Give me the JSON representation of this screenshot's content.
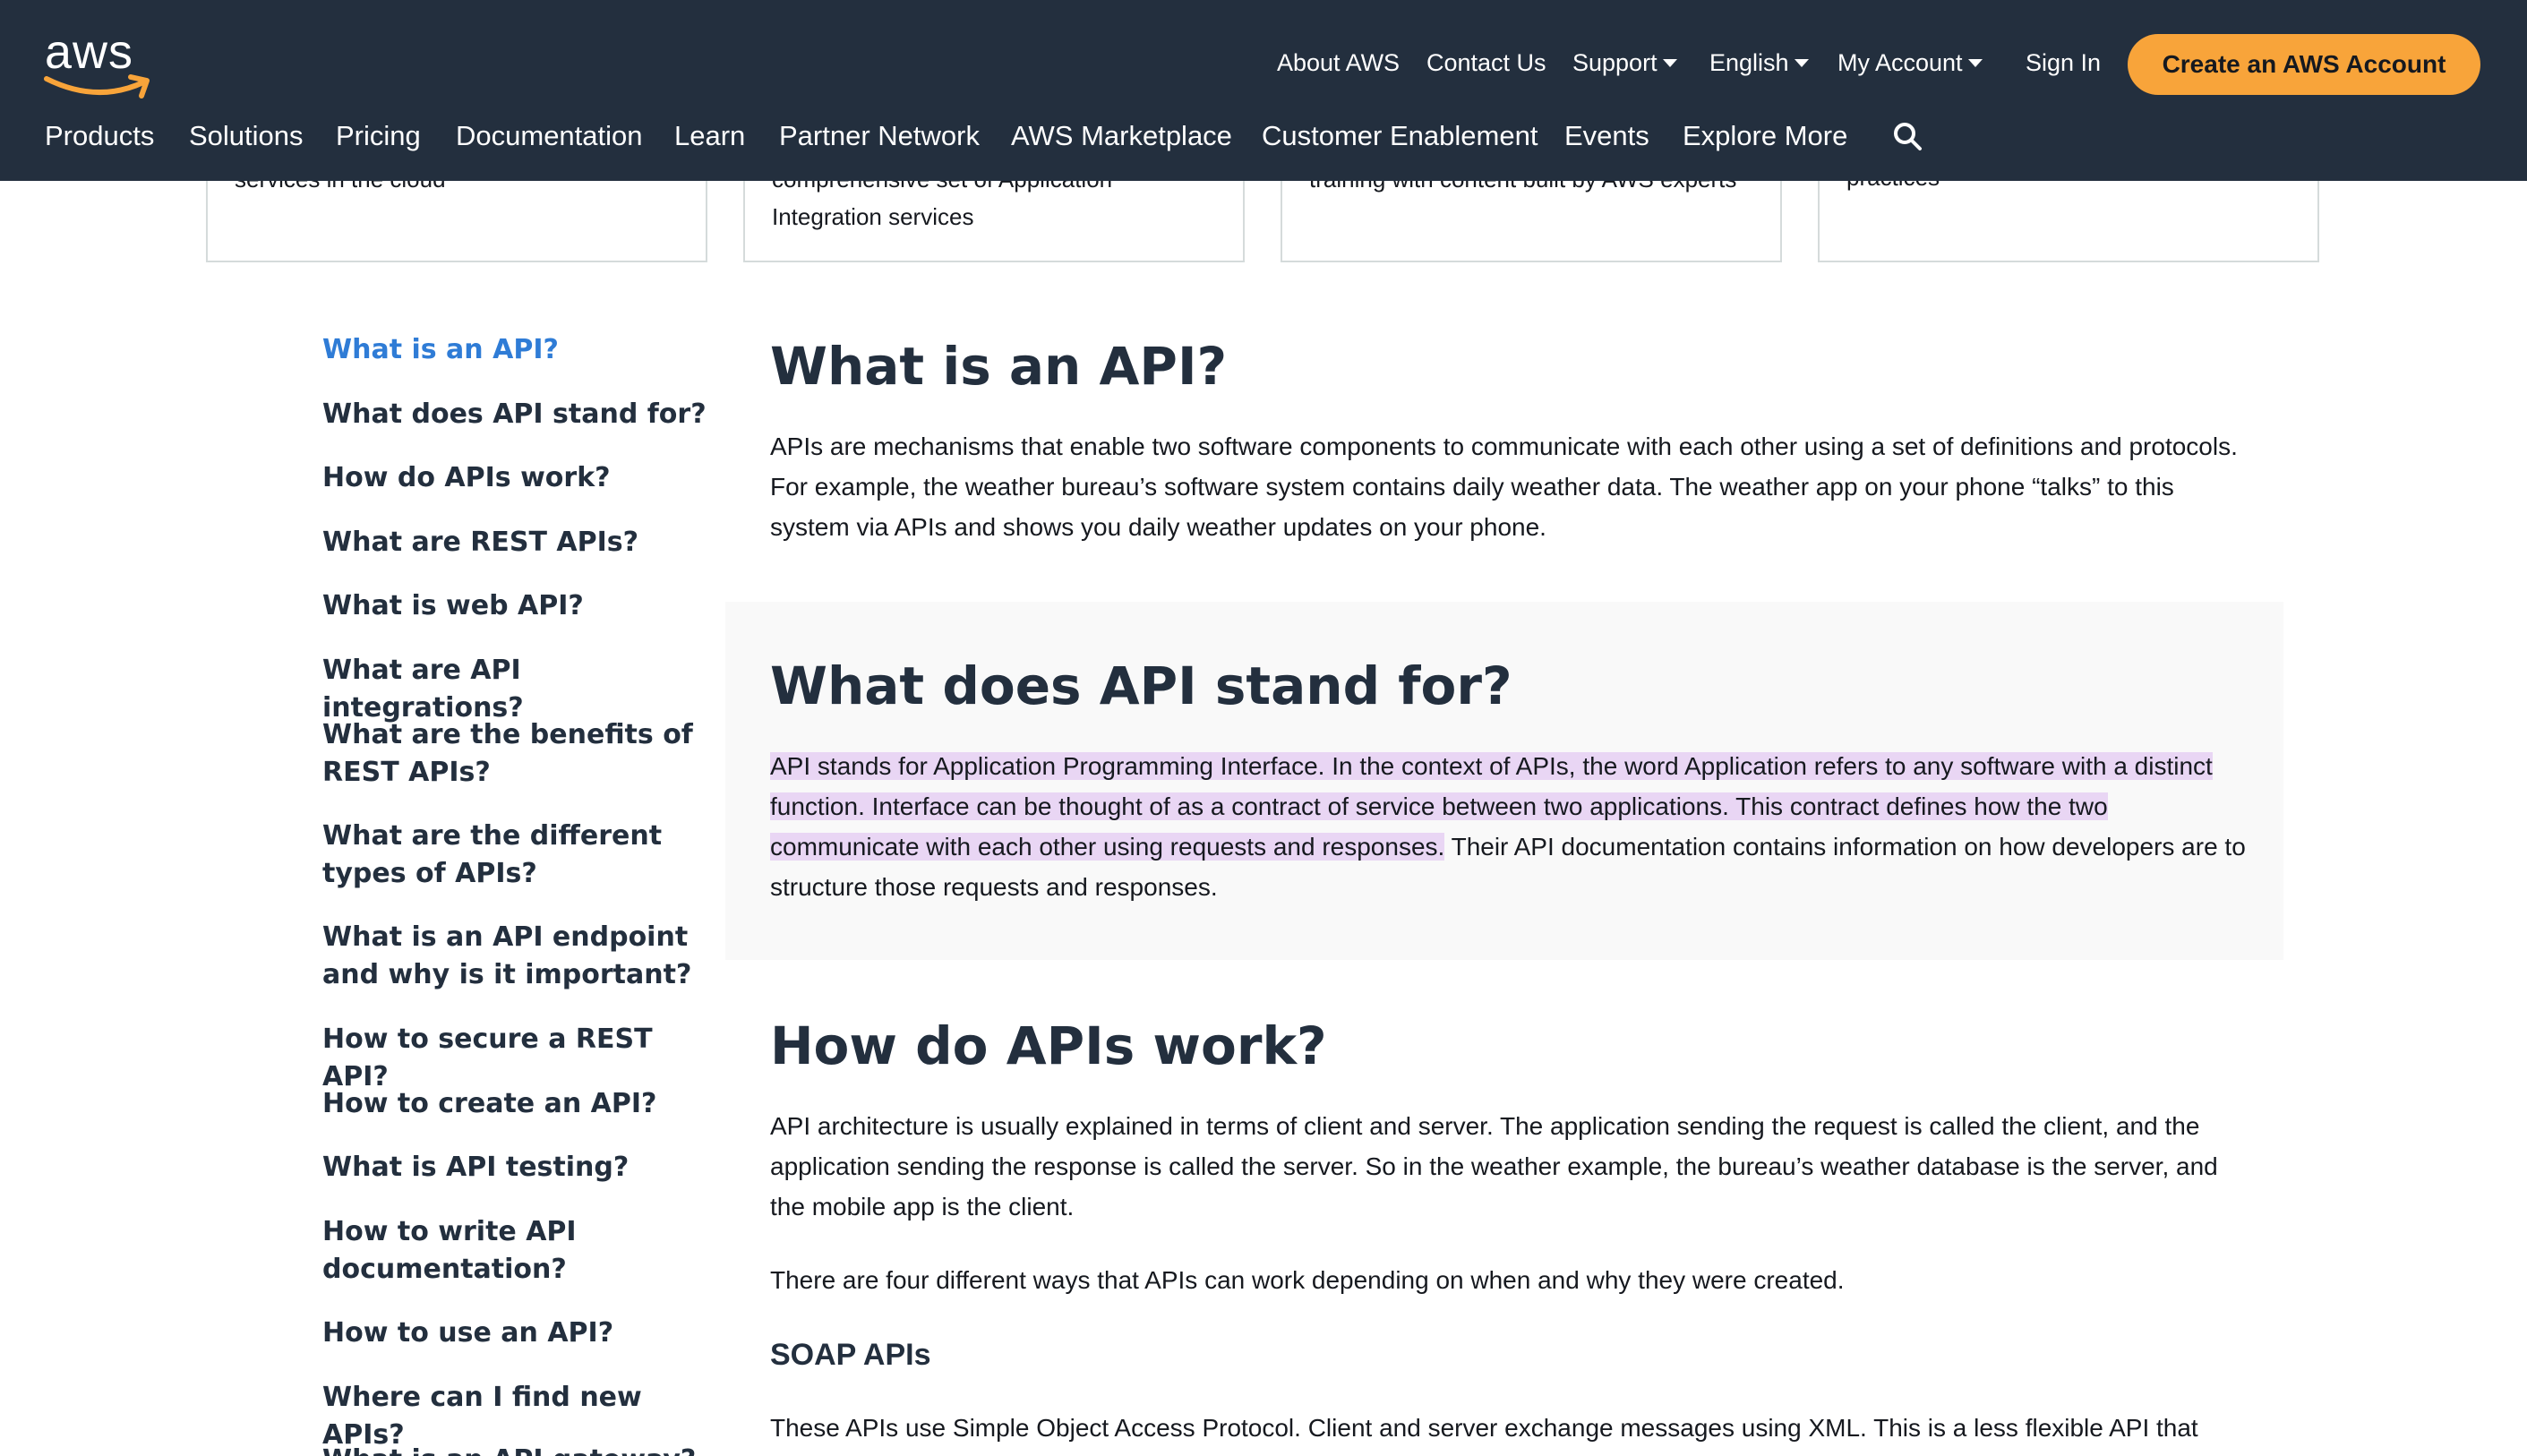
{
  "header": {
    "logo_text": "aws",
    "utility": {
      "about": "About AWS",
      "contact": "Contact Us",
      "support": "Support",
      "language": "English",
      "account": "My Account",
      "sign_in": "Sign In",
      "create_account": "Create an AWS Account"
    },
    "nav": [
      "Products",
      "Solutions",
      "Pricing",
      "Documentation",
      "Learn",
      "Partner Network",
      "AWS Marketplace",
      "Customer Enablement",
      "Events",
      "Explore More"
    ],
    "colors": {
      "background": "#232f3e",
      "cta": "#f8a43a"
    }
  },
  "cards": [
    {
      "lines": [
        "services in the cloud"
      ]
    },
    {
      "lines": [
        "comprehensive set of Application",
        "Integration services"
      ]
    },
    {
      "lines": [
        "training with content built by AWS experts"
      ]
    },
    {
      "lines": [
        "practices"
      ]
    }
  ],
  "toc": [
    {
      "label": "What is an API?",
      "active": true
    },
    {
      "label": "What does API stand for?"
    },
    {
      "label": "How do APIs work?"
    },
    {
      "label": "What are REST APIs?"
    },
    {
      "label": "What is web API?"
    },
    {
      "label": "What are API integrations?"
    },
    {
      "label": "What are the benefits of REST APIs?"
    },
    {
      "label": "What are the different types of APIs?"
    },
    {
      "label": "What is an API endpoint and why is it important?"
    },
    {
      "label": "How to secure a REST API?"
    },
    {
      "label": "How to create an API?"
    },
    {
      "label": "What is API testing?"
    },
    {
      "label": "How to write API documentation?"
    },
    {
      "label": "How to use an API?"
    },
    {
      "label": "Where can I find new APIs?"
    },
    {
      "label": "What is an API gateway?"
    }
  ],
  "content": {
    "s1_title": "What is an API?",
    "s1_p1": "APIs are mechanisms that enable two software components to communicate with each other using a set of definitions and protocols. For example, the weather bureau’s software system contains daily weather data. The weather app on your phone “talks” to this system via APIs and shows you daily weather updates on your phone.",
    "s2_title": "What does API stand for?",
    "s2_highlight": "API stands for Application Programming Interface. In the context of APIs, the word Application refers to any software with a distinct function. Interface can be thought of as a contract of service between two applications. This contract defines how the two communicate with each other using requests and responses.",
    "s2_rest": " Their API documentation contains information on how developers are to structure those requests and responses.",
    "s3_title": "How do APIs work?",
    "s3_p1": "API architecture is usually explained in terms of client and server. The application sending the request is called the client, and the application sending the response is called the server. So in the weather example, the bureau’s weather database is the server, and the mobile app is the client.",
    "s3_p2": "There are four different ways that APIs can work depending on when and why they were created.",
    "s3_sub": "SOAP APIs",
    "s3_p3": "These APIs use Simple Object Access Protocol. Client and server exchange messages using XML. This is a less flexible API that",
    "highlight_color": "#e9d6f4"
  }
}
